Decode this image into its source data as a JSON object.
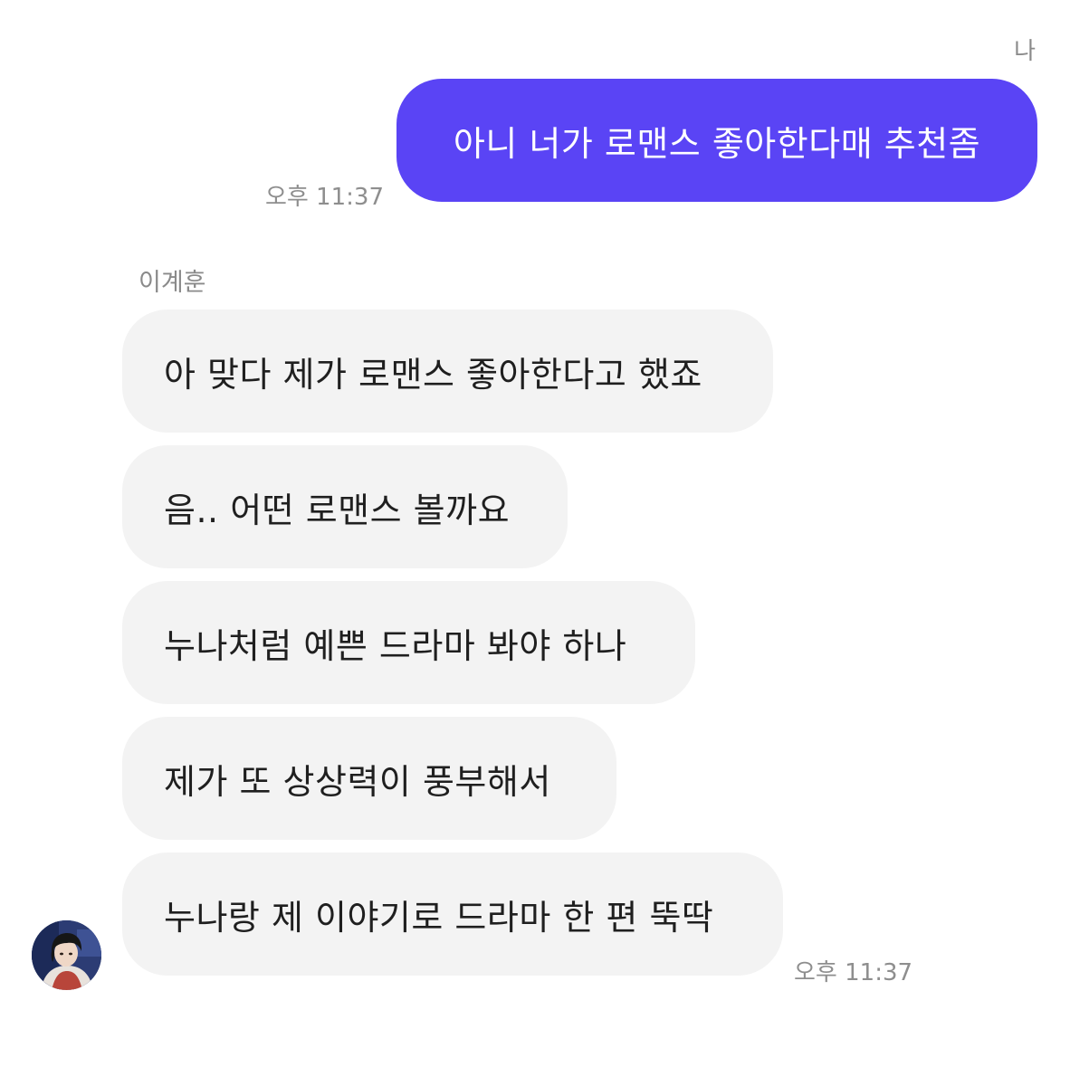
{
  "me": {
    "sender_label": "나",
    "message": "아니 너가 로맨스 좋아한다매 추천좀",
    "time": "오후 11:37",
    "bubble_color": "#5a44f5"
  },
  "other": {
    "sender_name": "이계훈",
    "avatar_icon": "profile-photo",
    "messages": [
      "아 맞다 제가 로맨스 좋아한다고 했죠",
      "음.. 어떤 로맨스 볼까요",
      "누나처럼 예쁜 드라마 봐야 하나",
      "제가 또 상상력이 풍부해서",
      "누나랑 제 이야기로 드라마 한 편 뚝딱"
    ],
    "time": "오후 11:37",
    "bubble_color": "#f3f3f3"
  }
}
